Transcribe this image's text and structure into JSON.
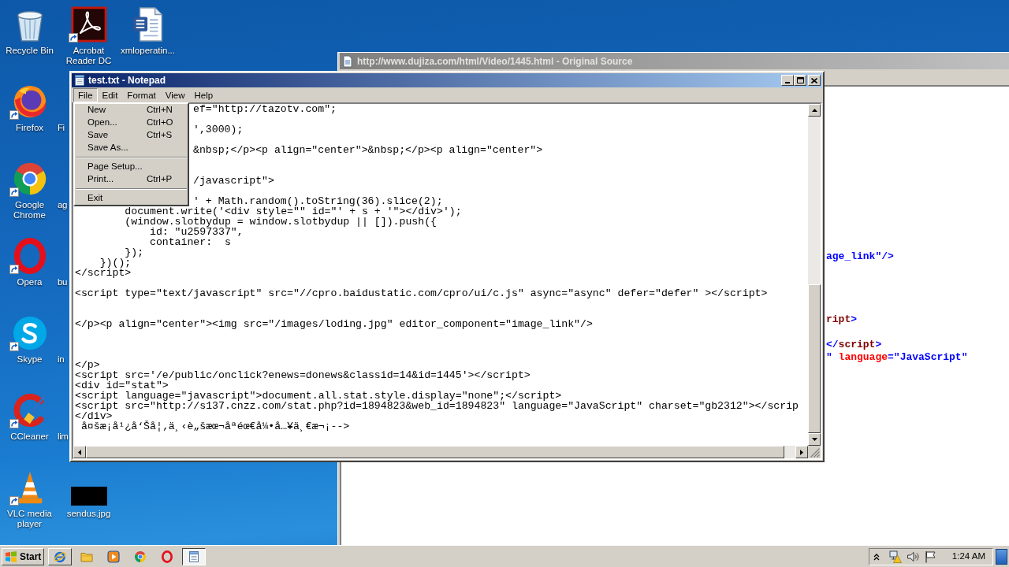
{
  "desktop": {
    "columns": [
      [
        {
          "label": "Recycle Bin",
          "kind": "recycle-bin",
          "shortcut_arrow": false
        },
        {
          "label": "Firefox",
          "kind": "firefox",
          "shortcut_arrow": true
        },
        {
          "label": "Google Chrome",
          "kind": "chrome",
          "shortcut_arrow": true
        },
        {
          "label": "Opera",
          "kind": "opera",
          "shortcut_arrow": true
        },
        {
          "label": "Skype",
          "kind": "skype",
          "shortcut_arrow": true
        },
        {
          "label": "CCleaner",
          "kind": "ccleaner",
          "shortcut_arrow": true
        },
        {
          "label": "VLC media player",
          "kind": "vlc",
          "shortcut_arrow": true
        }
      ],
      [
        {
          "label": "Acrobat Reader DC",
          "kind": "acrobat",
          "shortcut_arrow": true
        },
        {
          "label": "Fi",
          "kind": "covered"
        },
        {
          "label": "ag",
          "kind": "covered"
        },
        {
          "label": "bu",
          "kind": "covered"
        },
        {
          "label": "in",
          "kind": "covered"
        },
        {
          "label": "lim",
          "kind": "covered"
        },
        {
          "label": "sendus.jpg",
          "kind": "image",
          "shortcut_arrow": false
        }
      ],
      [
        {
          "label": "xmloperatin...",
          "kind": "word-document",
          "shortcut_arrow": false
        }
      ]
    ]
  },
  "source_window": {
    "title": "http://www.dujiza.com/html/Video/1445.html - Original Source",
    "tokens": [
      {
        "text": "\n\n\n\n\n\n\n\n\n\n\n\n\nage_link\"/>",
        "color": "#0000ff"
      },
      {
        "text": "\n\n\n\n\nript",
        "color": "#800000"
      },
      {
        "text": ">",
        "color": "#0000ff"
      },
      {
        "text": "\n\n</",
        "color": "#0000ff"
      },
      {
        "text": "script",
        "color": "#800000"
      },
      {
        "text": ">",
        "color": "#0000ff"
      },
      {
        "text": "\n\"",
        "color": "#0000ff"
      },
      {
        "text": " language",
        "color": "#ff0000"
      },
      {
        "text": "=",
        "color": "#0000ff"
      },
      {
        "text": "\"JavaScript\"",
        "color": "#0000ff"
      }
    ]
  },
  "notepad": {
    "title": "test.txt - Notepad",
    "menus": [
      {
        "label": "File",
        "selected": true,
        "items": [
          {
            "kind": "command",
            "label": "New",
            "shortcut": "Ctrl+N"
          },
          {
            "kind": "command",
            "label": "Open...",
            "shortcut": "Ctrl+O"
          },
          {
            "kind": "command",
            "label": "Save",
            "shortcut": "Ctrl+S"
          },
          {
            "kind": "command",
            "label": "Save As..."
          },
          {
            "kind": "separator"
          },
          {
            "kind": "command",
            "label": "Page Setup..."
          },
          {
            "kind": "command",
            "label": "Print...",
            "shortcut": "Ctrl+P"
          },
          {
            "kind": "separator"
          },
          {
            "kind": "command",
            "label": "Exit"
          }
        ]
      },
      {
        "label": "Edit",
        "selected": false
      },
      {
        "label": "Format",
        "selected": false
      },
      {
        "label": "View",
        "selected": false
      },
      {
        "label": "Help",
        "selected": false
      }
    ],
    "text": "ef=\"http://tazotv.com\";\n\n',3000);\n\n&nbsp;</p><p align=\"center\">&nbsp;</p><p align=\"center\">\n\n\n/javascript\">\n\n' + Math.random().toString(36).slice(2);\n        document.write('<div style=\"\" id=\"' + s + '\"></div>');\n        (window.slotbydup = window.slotbydup || []).push({\n            id: \"u2597337\",\n            container:  s\n        });\n    })();\n</script>\n\n<script type=\"text/javascript\" src=\"//cpro.baidustatic.com/cpro/ui/c.js\" async=\"async\" defer=\"defer\" ></script>\n\n\n</p><p align=\"center\"><img src=\"/images/loding.jpg\" editor_component=\"image_link\"/>\n\n\n\n</p>\n<script src='/e/public/onclick?enews=donews&classid=14&id=1445'></script>\n<div id=\"stat\">\n<script language=\"javascript\">document.all.stat.style.display=\"none\";</script>\n<script src=\"http://s137.cnzz.com/stat.php?id=1894823&web_id=1894823\" language=\"JavaScript\" charset=\"gb2312\"></scrip\n</div>\n å¤šæ¡å¹¿å‘Šå¦‚ä¸‹è„šæœ¬åªéœ€å¼•å…¥ä¸€æ¬¡-->"
  },
  "taskbar": {
    "start": "Start",
    "buttons": [
      {
        "kind": "ie",
        "running": true,
        "selected": false
      },
      {
        "kind": "folder",
        "running": false,
        "selected": false
      },
      {
        "kind": "media",
        "running": false,
        "selected": false
      },
      {
        "kind": "chrome",
        "running": false,
        "selected": false
      },
      {
        "kind": "opera",
        "running": false,
        "selected": false
      },
      {
        "kind": "notepad",
        "running": true,
        "selected": true
      }
    ],
    "clock": "1:24 AM"
  }
}
